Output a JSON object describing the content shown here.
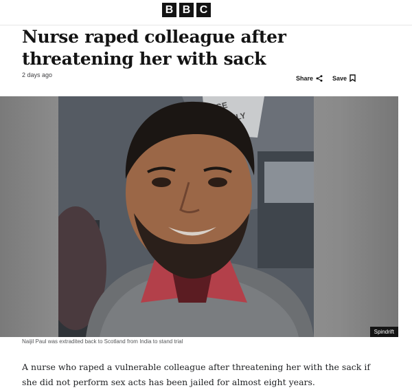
{
  "brand": {
    "letters": [
      "B",
      "B",
      "C"
    ]
  },
  "article": {
    "headline": "Nurse raped colleague after threatening her with sack",
    "timestamp": "2 days ago",
    "actions": {
      "share_label": "Share",
      "save_label": "Save"
    },
    "image": {
      "credit": "Spindrift",
      "caption": "Naijil Paul was extradited back to Scotland from India to stand trial",
      "sign_text": [
        "GE",
        "AT ONLY"
      ]
    },
    "lead_paragraph": "A nurse who raped a vulnerable colleague after threatening her with the sack if she did not perform sex acts has been jailed for almost eight years."
  },
  "icons": {
    "share": "share-icon",
    "save": "bookmark-icon"
  }
}
